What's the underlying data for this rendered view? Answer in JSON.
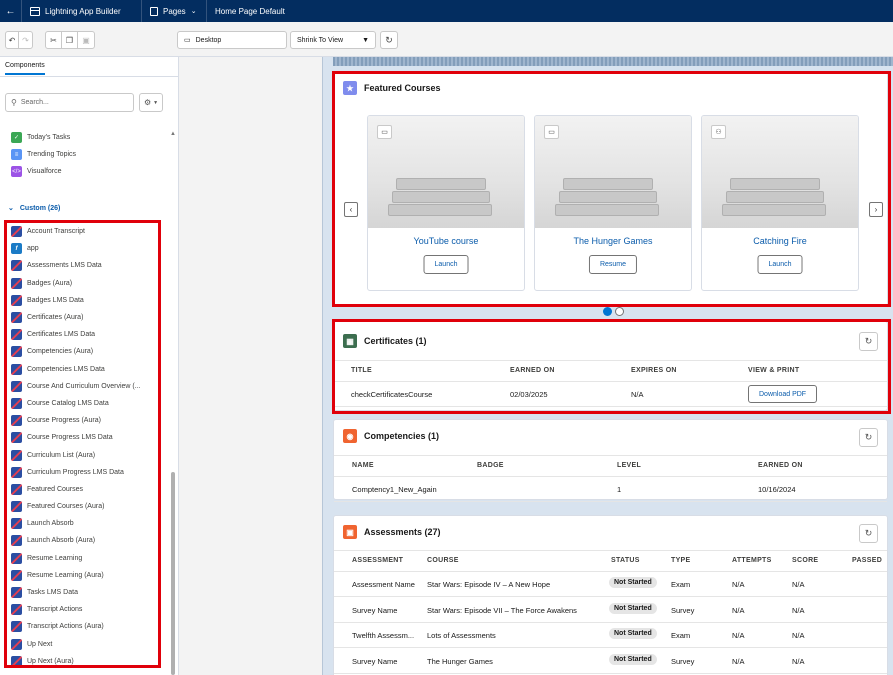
{
  "topbar": {
    "back": "←",
    "app_title": "Lightning App Builder",
    "pages_label": "Pages",
    "page_name": "Home Page Default"
  },
  "toolbar": {
    "device": "Desktop",
    "view": "Shrink To View"
  },
  "sidebar": {
    "tab": "Components",
    "search_placeholder": "Search...",
    "standard_items": [
      {
        "label": "Today's Tasks",
        "icon": "tasks-icon"
      },
      {
        "label": "Trending Topics",
        "icon": "topics-icon"
      },
      {
        "label": "Visualforce",
        "icon": "visualforce-icon"
      }
    ],
    "custom_header": "Custom (26)",
    "custom_items": [
      "Account Transcript",
      "app",
      "Assessments LMS Data",
      "Badges (Aura)",
      "Badges LMS Data",
      "Certificates (Aura)",
      "Certificates LMS Data",
      "Competencies (Aura)",
      "Competencies LMS Data",
      "Course And Curriculum Overview (...",
      "Course Catalog LMS Data",
      "Course Progress (Aura)",
      "Course Progress LMS Data",
      "Curriculum List (Aura)",
      "Curriculum Progress LMS Data",
      "Featured Courses",
      "Featured Courses (Aura)",
      "Launch Absorb",
      "Launch Absorb (Aura)",
      "Resume Learning",
      "Resume Learning (Aura)",
      "Tasks LMS Data",
      "Transcript Actions",
      "Transcript Actions (Aura)",
      "Up Next",
      "Up Next (Aura)"
    ]
  },
  "featured": {
    "title": "Featured Courses",
    "courses": [
      {
        "name": "YouTube course",
        "action": "Launch",
        "type_icon": "presentation-icon"
      },
      {
        "name": "The Hunger Games",
        "action": "Resume",
        "type_icon": "presentation-icon"
      },
      {
        "name": "Catching Fire",
        "action": "Launch",
        "type_icon": "group-icon"
      }
    ]
  },
  "certificates": {
    "title": "Certificates (1)",
    "columns": [
      "TITLE",
      "EARNED ON",
      "EXPIRES ON",
      "VIEW & PRINT"
    ],
    "rows": [
      {
        "title": "checkCertificatesCourse",
        "earned": "02/03/2025",
        "expires": "N/A",
        "action": "Download PDF"
      }
    ]
  },
  "competencies": {
    "title": "Competencies (1)",
    "columns": [
      "NAME",
      "BADGE",
      "LEVEL",
      "EARNED ON"
    ],
    "rows": [
      {
        "name": "Comptency1_New_Again",
        "badge": "",
        "level": "1",
        "earned": "10/16/2024"
      }
    ]
  },
  "assessments": {
    "title": "Assessments (27)",
    "columns": [
      "ASSESSMENT",
      "COURSE",
      "STATUS",
      "TYPE",
      "ATTEMPTS",
      "SCORE",
      "PASSED"
    ],
    "rows": [
      {
        "assessment": "Assessment Name",
        "course": "Star Wars: Episode IV – A New Hope",
        "status": "Not Started",
        "type": "Exam",
        "attempts": "N/A",
        "score": "N/A"
      },
      {
        "assessment": "Survey Name",
        "course": "Star Wars: Episode VII – The Force Awakens",
        "status": "Not Started",
        "type": "Survey",
        "attempts": "N/A",
        "score": "N/A"
      },
      {
        "assessment": "Twelfth Assessm...",
        "course": "Lots of Assessments",
        "status": "Not Started",
        "type": "Exam",
        "attempts": "N/A",
        "score": "N/A"
      },
      {
        "assessment": "Survey Name",
        "course": "The Hunger Games",
        "status": "Not Started",
        "type": "Survey",
        "attempts": "N/A",
        "score": "N/A"
      }
    ]
  },
  "colors": {
    "header_navy": "#032d60",
    "highlight_red": "#e0000a",
    "link_blue": "#0b5cab",
    "featured_tile": "#7f8ced",
    "certificates_tile": "#3c6e4f",
    "competencies_tile": "#f06430",
    "assessments_tile": "#f06430"
  }
}
